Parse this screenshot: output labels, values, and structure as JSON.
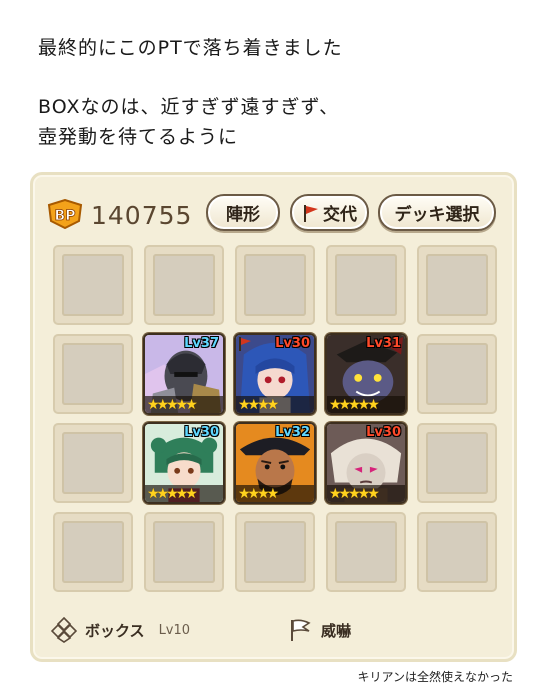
{
  "notes": {
    "line1": "最終的にこのPTで落ち着きました",
    "line2": "BOXなのは、近すぎず遠すぎず、",
    "line3": "壺発動を待てるように"
  },
  "caption": "キリアンは全然使えなかった",
  "party": {
    "bp_label": "BP",
    "bp_value": "140755",
    "buttons": {
      "formation": "陣形",
      "swap": "交代",
      "deck_select": "デッキ選択"
    }
  },
  "units": [
    {
      "level": "Lv37",
      "stars": "★★★★★",
      "level_color": "blue"
    },
    {
      "level": "Lv30",
      "stars": "★★★★",
      "level_color": "red",
      "leader": true
    },
    {
      "level": "Lv31",
      "stars": "★★★★★",
      "level_color": "red"
    },
    {
      "level": "Lv30",
      "stars": "★★★★★",
      "level_color": "blue"
    },
    {
      "level": "Lv32",
      "stars": "★★★★",
      "level_color": "blue"
    },
    {
      "level": "Lv30",
      "stars": "★★★★★",
      "level_color": "red"
    }
  ],
  "footer": {
    "formation_name": "ボックス",
    "formation_level": "Lv10",
    "leader_skill": "威嚇"
  },
  "colors": {
    "panel_bg": "#f4eed9",
    "bp_badge": "#f3a21a",
    "flag_red": "#d2361c"
  }
}
